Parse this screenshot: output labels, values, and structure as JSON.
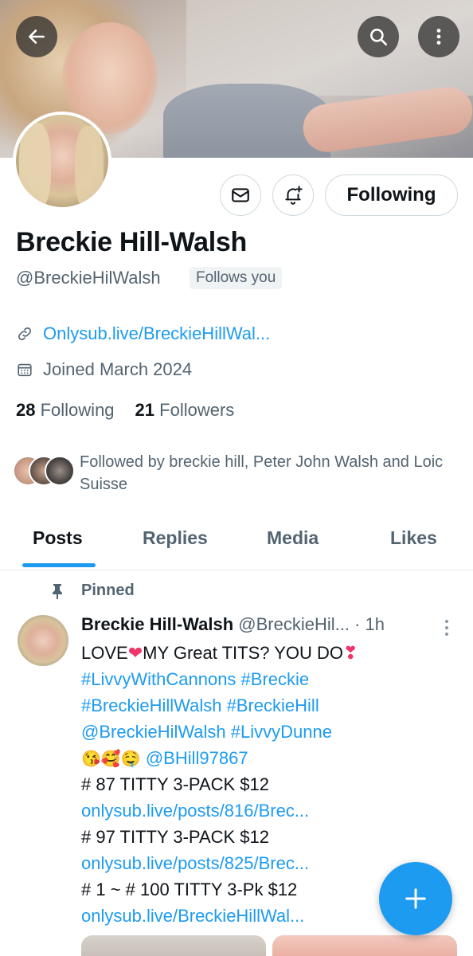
{
  "profile": {
    "name": "Breckie Hill-Walsh",
    "handle": "@BreckieHilWalsh",
    "follows_you_badge": "Follows you",
    "website": "Onlysub.live/BreckieHillWal...",
    "joined": "Joined March 2024",
    "following_count": "28",
    "following_label": "Following",
    "followers_count": "21",
    "followers_label": "Followers",
    "followed_by": "Followed by breckie hill, Peter John Walsh and Loic Suisse",
    "follow_button_label": "Following"
  },
  "tabs": [
    {
      "label": "Posts",
      "active": true
    },
    {
      "label": "Replies",
      "active": false
    },
    {
      "label": "Media",
      "active": false
    },
    {
      "label": "Likes",
      "active": false
    }
  ],
  "post": {
    "pinned_label": "Pinned",
    "author_name": "Breckie Hill-Walsh",
    "author_handle": "@BreckieHil...",
    "time": "· 1h",
    "lines": {
      "l1a": "LOVE",
      "l1b": "MY Great TITS? YOU DO",
      "l2": "#LivvyWithCannons #Breckie",
      "l3": "#BreckieHillWalsh #BreckieHill",
      "l4": "@BreckieHilWalsh #LivvyDunne",
      "l5_emoji": "😘🥰🤤",
      "l5_mention": "@BHill97867",
      "l6": "# 87 TITTY 3-PACK $12",
      "l7": "onlysub.live/posts/816/Brec...",
      "l8": "# 97 TITTY 3-PACK $12",
      "l9": "onlysub.live/posts/825/Brec...",
      "l10": "# 1 ~ # 100 TITTY 3-Pk $12",
      "l11": "onlysub.live/BreckieHillWal..."
    },
    "heart1": "❤",
    "heart2": "❣"
  },
  "colors": {
    "accent": "#1d9bf0",
    "text": "#0f1419",
    "muted": "#536471"
  },
  "icons": [
    "back-arrow-icon",
    "search-icon",
    "more-vertical-icon",
    "mail-icon",
    "bell-plus-icon",
    "link-icon",
    "calendar-icon",
    "pin-icon",
    "plus-icon"
  ]
}
